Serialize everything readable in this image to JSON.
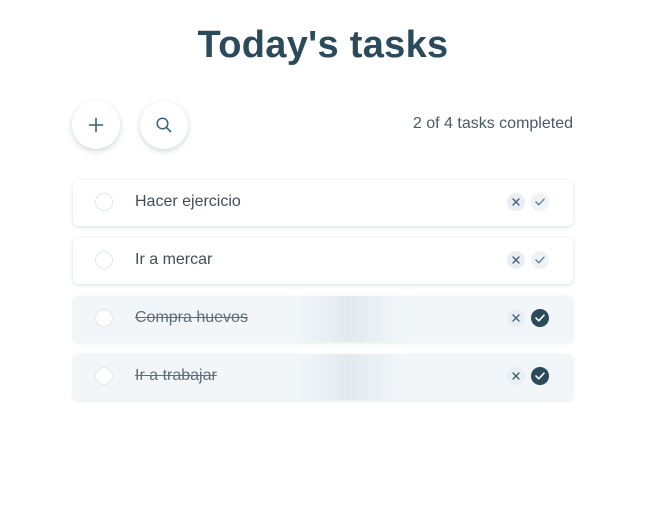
{
  "header": {
    "title": "Today's tasks"
  },
  "toolbar": {
    "add_icon": "plus-icon",
    "search_icon": "search-icon",
    "counter_text": "2 of 4 tasks completed"
  },
  "tasks": [
    {
      "label": "Hacer ejercicio",
      "completed": false
    },
    {
      "label": "Ir a mercar",
      "completed": false
    },
    {
      "label": "Compra huevos",
      "completed": true
    },
    {
      "label": "Ir a trabajar",
      "completed": true
    }
  ],
  "colors": {
    "title": "#2b4a5b",
    "accent": "#2b4a5b",
    "done_background": "#f2f6f9"
  }
}
